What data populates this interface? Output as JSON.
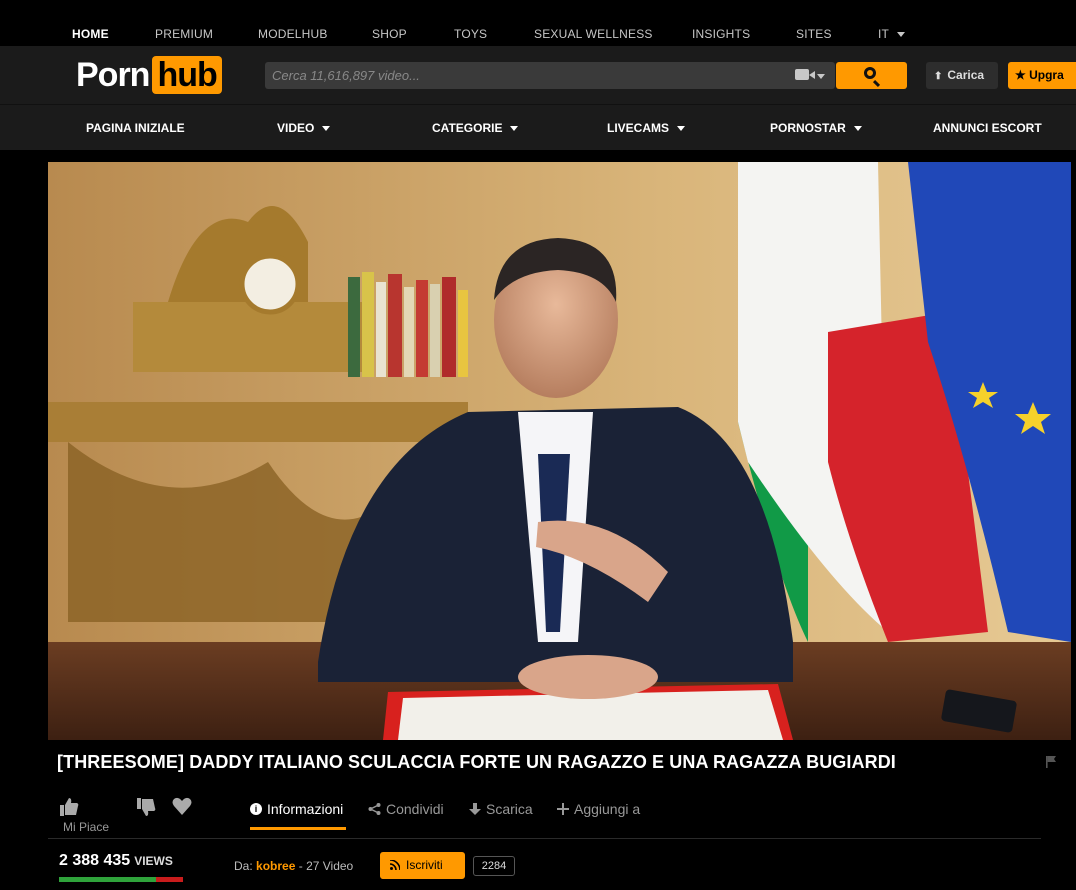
{
  "topnav": {
    "items": [
      "HOME",
      "PREMIUM",
      "MODELHUB",
      "SHOP",
      "TOYS",
      "SEXUAL WELLNESS",
      "INSIGHTS",
      "SITES",
      "IT"
    ]
  },
  "header": {
    "logo_left": "Porn",
    "logo_right": "hub",
    "search_placeholder": "Cerca 11,616,897 video...",
    "upload_label": "Carica",
    "upgrade_label": "★ Upgra"
  },
  "mainnav": {
    "items": [
      "PAGINA INIZIALE",
      "VIDEO",
      "CATEGORIE",
      "LIVECAMS",
      "PORNOSTAR",
      "ANNUNCI ESCORT"
    ]
  },
  "video": {
    "title": "[THREESOME] DADDY ITALIANO SCULACCIA FORTE UN RAGAZZO E UNA RAGAZZA BUGIARDI"
  },
  "actions": {
    "like_label": "Mi Piace",
    "tabs": [
      "Informazioni",
      "Condividi",
      "Scarica",
      "Aggiungi a"
    ]
  },
  "stats": {
    "views": "2 388 435",
    "views_label": "VIEWS",
    "rating_fraction": 0.78,
    "uploader_prefix": "Da:",
    "uploader": "kobree",
    "video_count": "- 27 Video",
    "subscribe_label": "Iscriviti",
    "subscriber_count": "2284"
  },
  "colors": {
    "accent": "#ff9900",
    "header_bg": "#1b1b1b",
    "rating_good": "#2fa33b",
    "rating_bad": "#c91c1c"
  }
}
